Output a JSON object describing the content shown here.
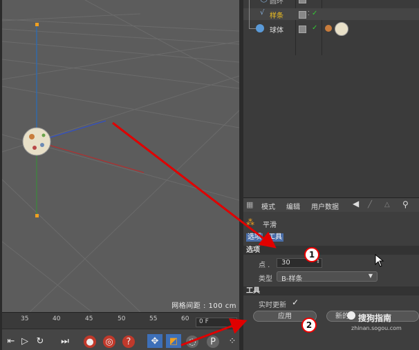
{
  "viewport": {
    "grid_label": "网格间距 : 100 cm"
  },
  "timeline": {
    "ticks": [
      "35",
      "40",
      "45",
      "50",
      "55",
      "60"
    ],
    "frame_value": "0 F"
  },
  "object_manager": {
    "rows": [
      {
        "name": "圆环"
      },
      {
        "name": "样条"
      },
      {
        "name": "球体"
      }
    ]
  },
  "attributes": {
    "menu": {
      "mode": "模式",
      "edit": "编辑",
      "user_data": "用户数据"
    },
    "object_name": "平滑",
    "tabs": {
      "options": "选项",
      "tools": "工具"
    },
    "section_options": "选项",
    "points_label": "点 .",
    "points_value": "30",
    "type_label": "类型",
    "type_value": "B-样条",
    "section_tools": "工具",
    "realtime_label": "实时更新",
    "apply_label": "应用",
    "new_label": "新的"
  },
  "watermark": {
    "brand": "搜狗指南",
    "url": "zhinan.sogou.com"
  },
  "annotations": {
    "badge_1": "1",
    "badge_2": "2"
  },
  "colors": {
    "viewport_bg": "#5c5c5c",
    "panel_bg": "#3e3e3e",
    "arrow_red": "#e00000",
    "selected_tab": "#4a6ea8",
    "spline_highlight": "#f0c020",
    "check_green": "#33cc33"
  }
}
